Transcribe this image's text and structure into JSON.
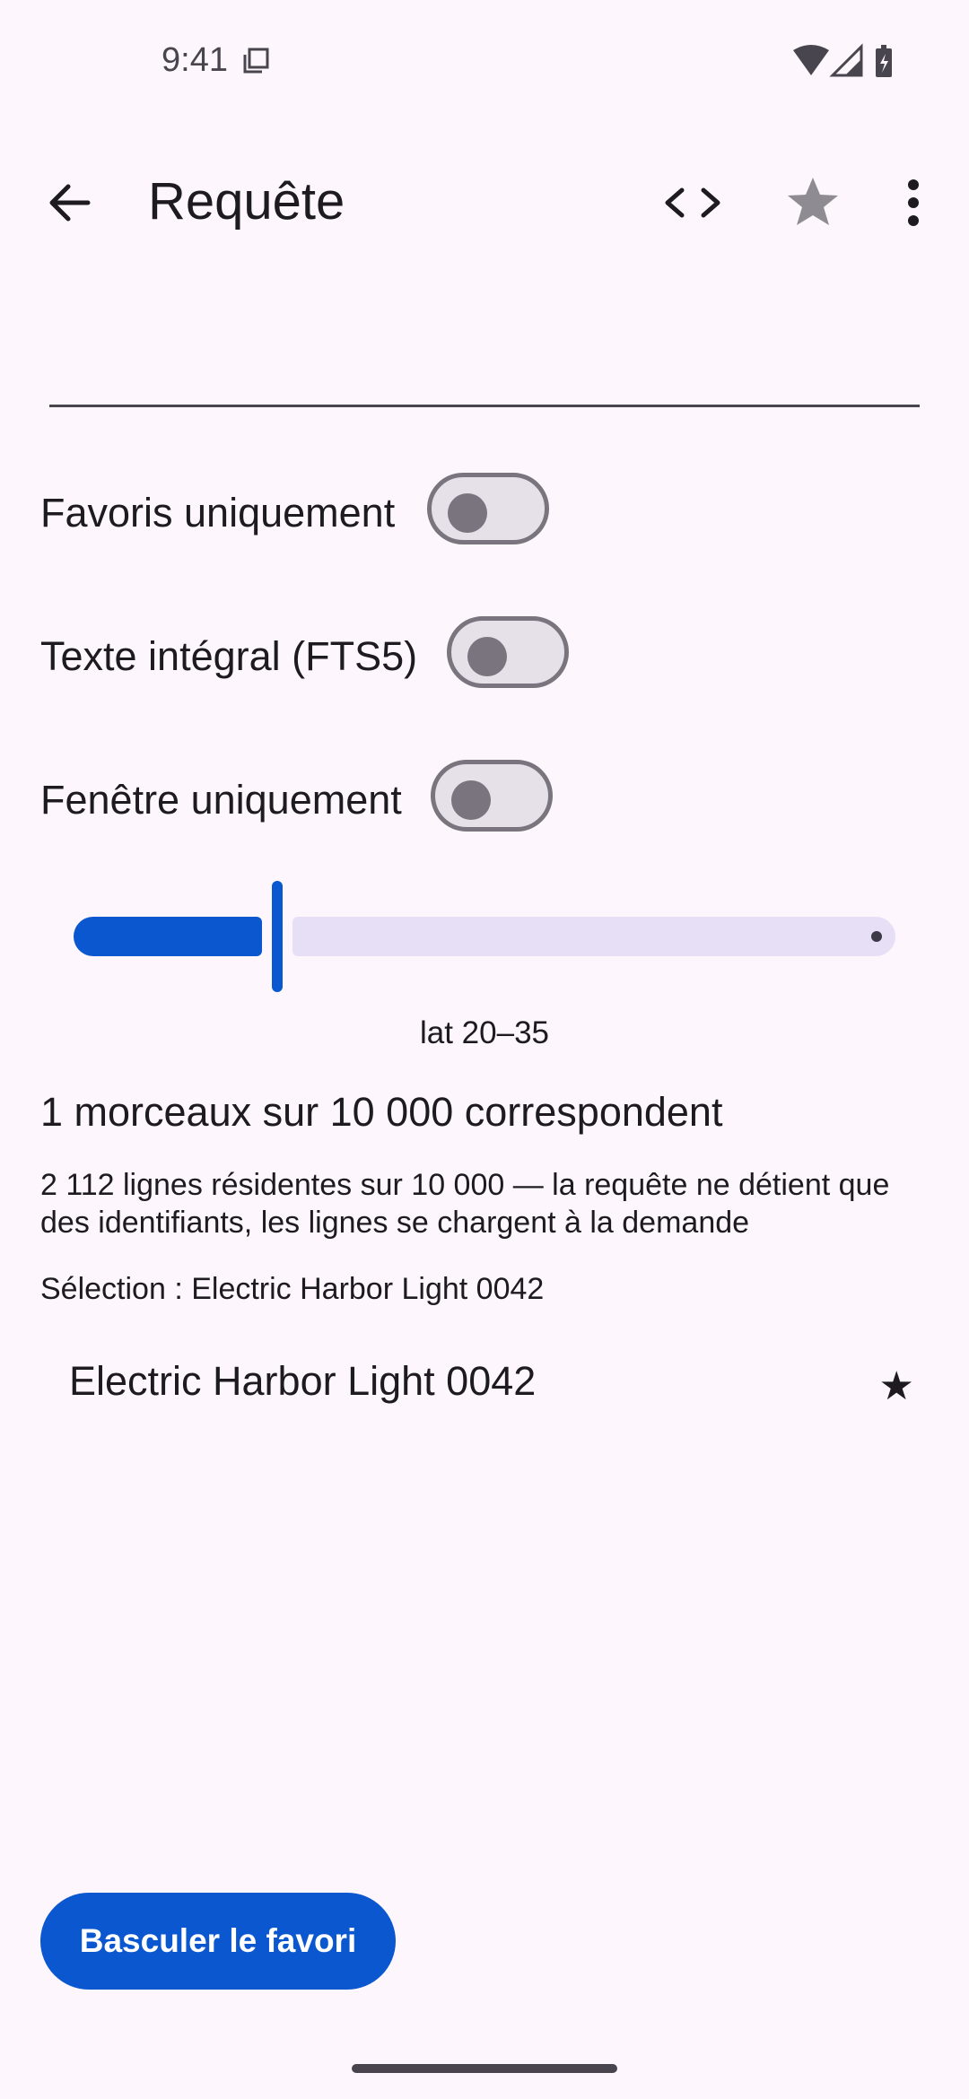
{
  "status_bar": {
    "time": "9:41"
  },
  "app_bar": {
    "title": "Requête",
    "icons": [
      "back-arrow-icon",
      "code-icon",
      "star-icon",
      "more-vert-icon"
    ]
  },
  "search": {
    "value": "",
    "placeholder": ""
  },
  "toggles": [
    {
      "label": "Favoris uniquement",
      "on": false
    },
    {
      "label": "Texte intégral (FTS5)",
      "on": false
    },
    {
      "label": "Fenêtre uniquement",
      "on": false
    }
  ],
  "slider": {
    "caption": "lat 20–35",
    "fraction": 0.24
  },
  "results": {
    "match_count": "1 morceaux sur 10 000 correspondent",
    "resident_info": "2 112 lignes résidentes sur 10 000 — la requête ne détient que des identifiants, les lignes se chargent à la demande",
    "selection": "Sélection : Electric Harbor Light 0042"
  },
  "list": {
    "items": [
      {
        "title": "Electric Harbor Light 0042",
        "star": "★"
      }
    ]
  },
  "actions": {
    "toggle_favorite": "Basculer le favori"
  },
  "colors": {
    "primary": "#0b57d0",
    "background": "#fdf7fd",
    "outline": "#79747e",
    "track_inactive": "#e7dff6"
  }
}
